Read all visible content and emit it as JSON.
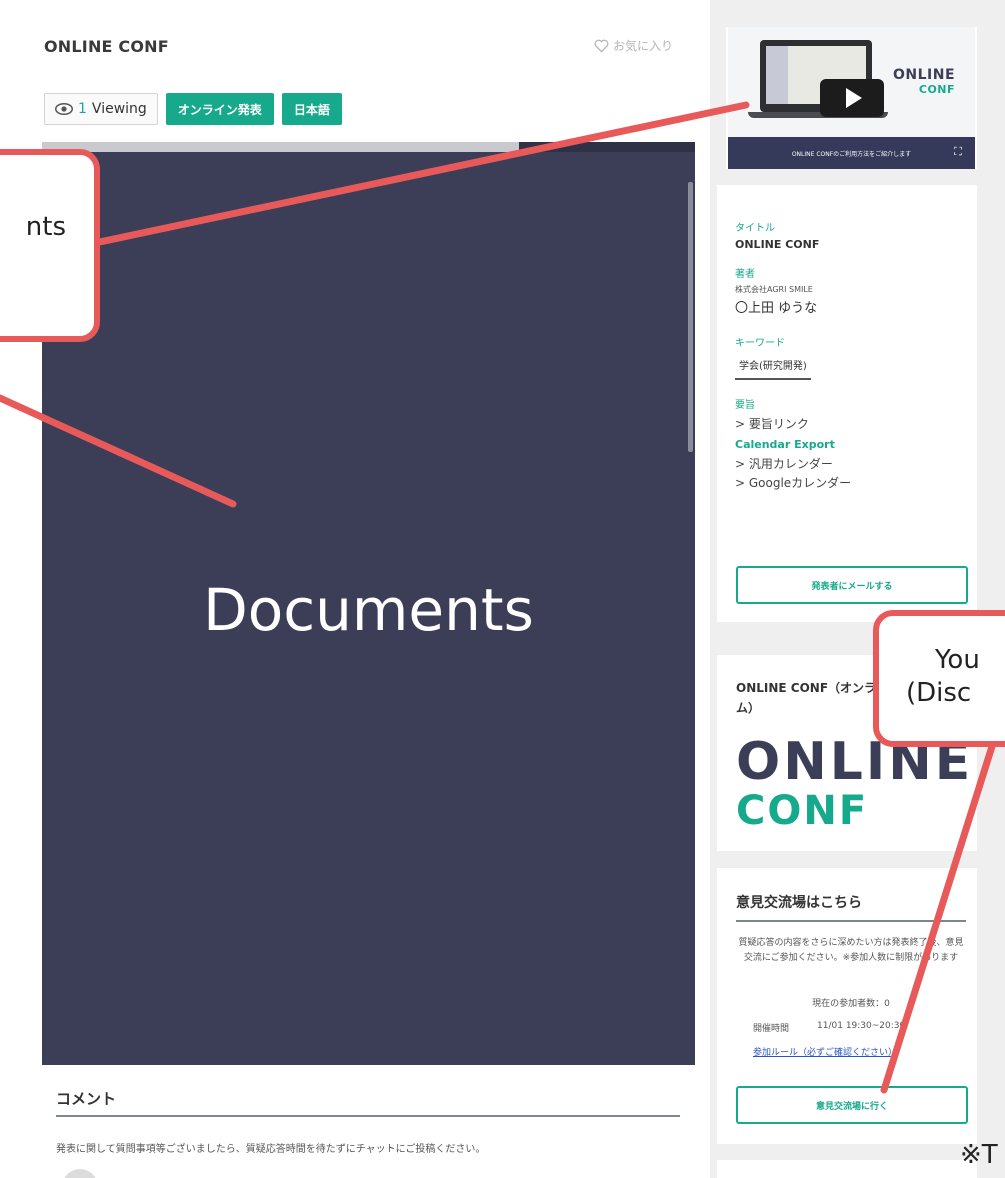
{
  "event": {
    "title": "ONLINE CONF",
    "favorite_label": "お気に入り",
    "viewing_count": "1",
    "viewing_label": "Viewing",
    "tags": [
      "オンライン発表",
      "日本語"
    ]
  },
  "documents": {
    "label": "Documents"
  },
  "comments": {
    "title": "コメント",
    "notice": "発表に関して質問事項等ございましたら、質疑応答時間を待たずにチャットにご投稿ください。"
  },
  "video": {
    "brand_line1": "ONLINE",
    "brand_line2": "CONF",
    "caption": "ONLINE CONFのご利用方法をご紹介します",
    "fullscreen_icon": "⛶"
  },
  "info": {
    "title_label": "タイトル",
    "title_value": "ONLINE CONF",
    "author_label": "著者",
    "author_org": "株式会社AGRI SMILE",
    "author_name": "〇上田 ゆうな",
    "keyword_label": "キーワード",
    "keyword_value": "学会(研究開発)",
    "abstract_label": "要旨",
    "abstract_link": "> 要旨リンク",
    "calendar_label": "Calendar Export",
    "calendar_generic": "> 汎用カレンダー",
    "calendar_google": "> Googleカレンダー",
    "email_button": "発表者にメールする"
  },
  "brand": {
    "title": "ONLINE CONF（オンライン学会システム）",
    "logo_line1": "ONLINE",
    "logo_line2": "CONF"
  },
  "discussion": {
    "title": "意見交流場はこちら",
    "desc": "質疑応答の内容をさらに深めたい方は発表終了後、意見交流にご参加ください。※参加人数に制限があります",
    "count": "現在の参加者数：0",
    "time_label": "開催時間",
    "time_value": "11/01 19:30~20:30",
    "rules_link": "参加ルール（必ずご確認ください）",
    "join_button": "意見交流場に行く"
  },
  "annotations": {
    "callout_left": "nts",
    "callout_right_line1": "You",
    "callout_right_line2": "(Disc",
    "footnote": "※T"
  },
  "colors": {
    "accent_green": "#17a98b",
    "document_bg": "#3c3e58",
    "callout_red": "#e85a5a"
  }
}
